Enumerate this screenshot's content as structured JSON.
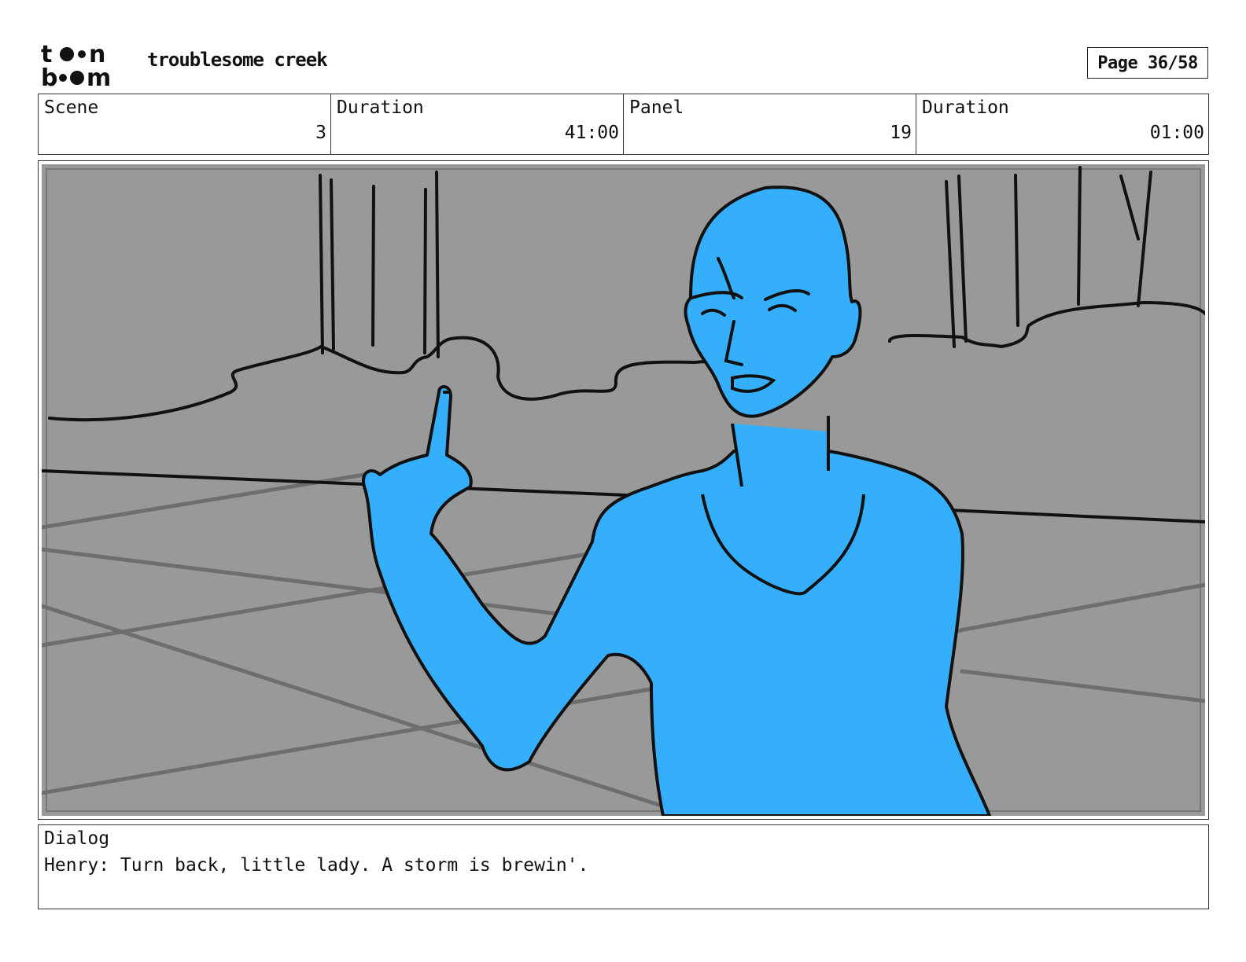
{
  "header": {
    "logo_text": [
      "to",
      "n",
      "b",
      "m"
    ],
    "project_title": "troublesome creek",
    "page_label": "Page 36/58"
  },
  "info": {
    "scene_label": "Scene",
    "scene_value": "3",
    "scene_duration_label": "Duration",
    "scene_duration_value": "41:00",
    "panel_label": "Panel",
    "panel_value": "19",
    "panel_duration_label": "Duration",
    "panel_duration_value": "01:00"
  },
  "panel": {
    "background_color": "#999999",
    "character_color": "#35aefc",
    "line_color": "#111111",
    "floor_line_color": "#6e6e6e"
  },
  "dialog": {
    "label": "Dialog",
    "text": "Henry: Turn back, little lady. A storm is brewin'."
  }
}
